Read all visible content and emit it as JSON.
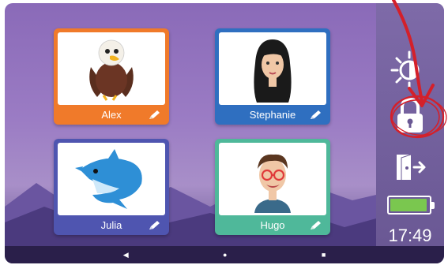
{
  "profiles": [
    {
      "name": "Alex",
      "avatar": "eagle-avatar",
      "color": "#f07a2a"
    },
    {
      "name": "Stephanie",
      "avatar": "woman-avatar",
      "color": "#2f6fc0"
    },
    {
      "name": "Julia",
      "avatar": "dolphin-avatar",
      "color": "#4f55b0"
    },
    {
      "name": "Hugo",
      "avatar": "man-glasses-avatar",
      "color": "#4fb89a"
    }
  ],
  "sidebar": {
    "brightness_icon": "sun-brightness-icon",
    "lock_icon": "lock-icon",
    "exit_icon": "door-exit-icon",
    "battery_level": 0.95,
    "battery_color": "#7ac74f",
    "clock": "17:49"
  },
  "navigation": {
    "back": "◀",
    "home": "●",
    "recents": "■"
  },
  "annotation_color": "#d4202a"
}
